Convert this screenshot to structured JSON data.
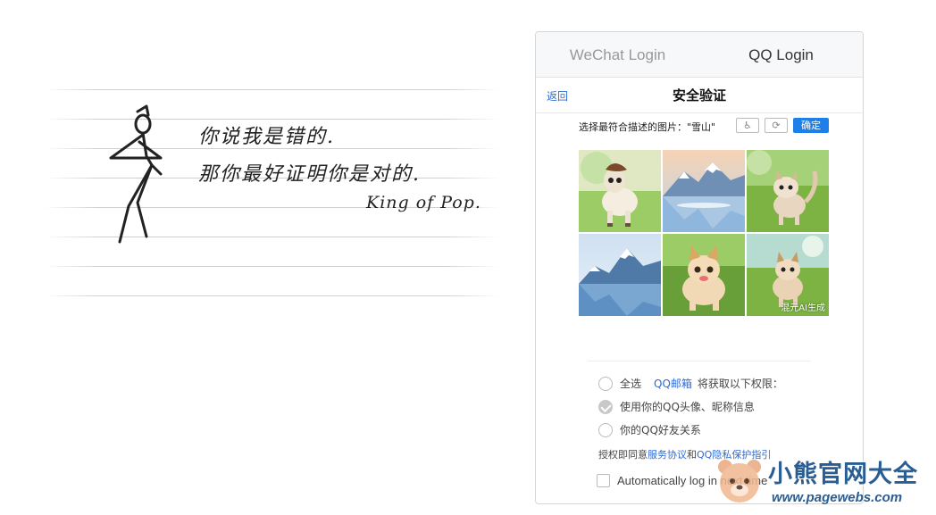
{
  "banner": {
    "line1": "你说我是错的.",
    "line2": "那你最好证明你是对的.",
    "signature": "King of Pop."
  },
  "tabs": [
    {
      "label": "WeChat Login",
      "active": false
    },
    {
      "label": "QQ Login",
      "active": true
    }
  ],
  "verify": {
    "back_label": "返回",
    "title": "安全验证",
    "prompt": "选择最符合描述的图片：\"雪山\"",
    "confirm_label": "确定",
    "watermark": "混元AI生成",
    "tiles": [
      "pony",
      "snow-mountain",
      "kitten",
      "snow-mountain",
      "kitten",
      "kitten"
    ]
  },
  "permissions": {
    "select_all": "全选",
    "app_name": "QQ邮箱",
    "request_text": "将获取以下权限：",
    "items": [
      "使用你的QQ头像、昵称信息",
      "你的QQ好友关系"
    ]
  },
  "agreement": {
    "prefix": "授权即同意",
    "service_link": "服务协议",
    "and": "和",
    "privacy_link": "QQ隐私保护指引"
  },
  "auto_login_label": "Automatically log in next time",
  "site_watermark": {
    "name": "小熊官网大全",
    "url": "www.pagewebs.com"
  },
  "colors": {
    "accent_blue": "#1e7fe8",
    "link_blue": "#2f6bd4",
    "watermark_blue": "#2a5d92"
  }
}
